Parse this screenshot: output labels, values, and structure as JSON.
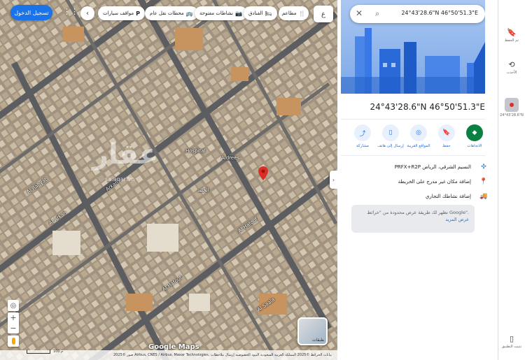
{
  "map": {
    "sign_in_label": "تسجيل الدخول",
    "apps_icon": "grid-icon",
    "chips": [
      {
        "id": "parking",
        "icon": "P",
        "label": "مواقف سيارات"
      },
      {
        "id": "transit",
        "icon": "🚌",
        "label": "محطات نقل عام"
      },
      {
        "id": "open",
        "icon": "📷",
        "label": "نشاطات مفتوحة"
      },
      {
        "id": "hotels",
        "icon": "🛏",
        "label": "الفنادق"
      },
      {
        "id": "restaurants",
        "icon": "🍴",
        "label": "مطاعم"
      }
    ],
    "lang_label": "ع",
    "labels": {
      "hospital": "Hospital",
      "aldrees": "Aldrees",
      "al_rahyat": "Al Rahyat",
      "arkan": "Arkan",
      "al_arkan": "Al Arkan",
      "al_hafouf": "Al Hafouf",
      "al_hafouf_2": "Al Hafouf",
      "aqar": "عقار",
      "aqar_url": "sa.aqar.fm",
      "store": "الجليد",
      "al_sala": "Al Saala"
    },
    "google_logo": "Google Maps",
    "scale_label": "100 م",
    "footer": "صور ©2025 Airbus, CNES / Airbus, Maxar Technologies, بيانات الخرائط ©2025   المملكة العربية السعودية   البنود   الخصوصية   إرسال ملاحظات",
    "layers_label": "طبقات"
  },
  "panel": {
    "search_query": "24°43'28.6\"N 46°50'51.3\"E",
    "title": "24°43'28.6\"N 46°50'51.3\"E",
    "actions": [
      {
        "id": "directions",
        "label": "الاتجاهات",
        "icon": "◆"
      },
      {
        "id": "save",
        "label": "حفظ",
        "icon": "🔖"
      },
      {
        "id": "nearby",
        "label": "المواقع القريبة",
        "icon": "◎"
      },
      {
        "id": "send",
        "label": "إرسال إلى هاتف",
        "icon": "▯"
      },
      {
        "id": "share",
        "label": "مشاركة",
        "icon": "⤴"
      }
    ],
    "info_rows": [
      {
        "id": "pluscode",
        "text": "PRFX+R2P النسيم الشرقي، الرياض",
        "icon": "✣"
      },
      {
        "id": "add_place",
        "text": "إضافة مكان غير مدرج على الخريطة",
        "icon": "📍"
      },
      {
        "id": "add_business",
        "text": "إضافة نشاطك التجاري",
        "icon": "🚚"
      }
    ],
    "notice_text": "تظهر لك طريقة عرض محدودة من \"خرائط Google\".",
    "notice_link": "عرض المزيد"
  },
  "rail": {
    "saved_label": "تم الحفظ",
    "recent_label": "الأحدث",
    "recent_place_label": "24°43'28.6\"N",
    "install_label": "تثبيت التطبيق"
  },
  "colors": {
    "accent": "#1a73e8",
    "pin": "#d93025",
    "directions": "#0b8043"
  }
}
